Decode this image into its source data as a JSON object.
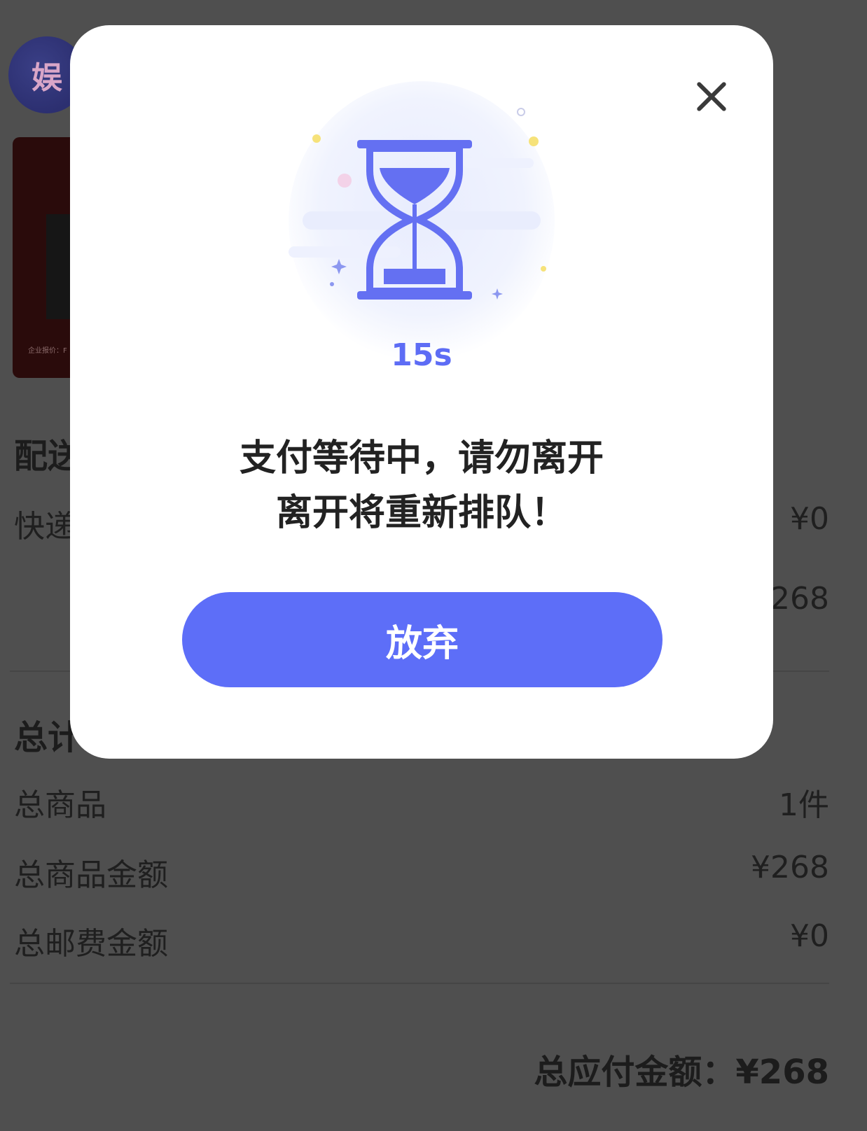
{
  "background": {
    "logo_text": "娱",
    "product_note": "企业报价：F",
    "delivery_section_title": "配送",
    "delivery_row_label": "快递",
    "delivery_row_value": "¥0",
    "subtotal_value": "¥268",
    "totals_section_title": "总计",
    "totals": [
      {
        "label": "总商品",
        "value": "1件"
      },
      {
        "label": "总商品金额",
        "value": "¥268"
      },
      {
        "label": "总邮费金额",
        "value": "¥0"
      }
    ],
    "grand_total_label": "总应付金额：",
    "grand_total_value": "¥268"
  },
  "modal": {
    "timer": "15s",
    "message_line1": "支付等待中，请勿离开",
    "message_line2": "离开将重新排队！",
    "abandon_button": "放弃",
    "close_icon": "close-icon",
    "illustration_icon": "hourglass-icon",
    "accent_color": "#5d6ef8"
  }
}
